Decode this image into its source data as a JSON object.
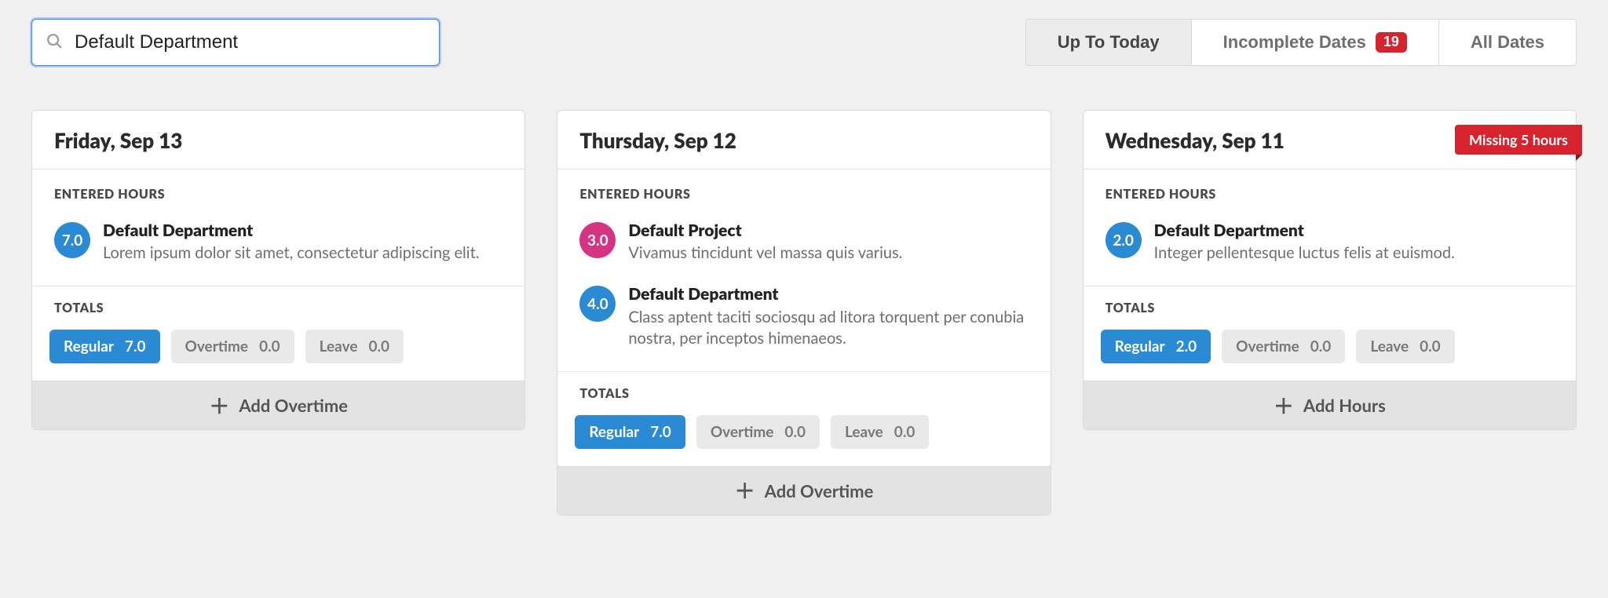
{
  "search": {
    "value": "Default Department"
  },
  "filters": {
    "up_to_today": "Up To Today",
    "incomplete": "Incomplete Dates",
    "incomplete_count": "19",
    "all_dates": "All Dates"
  },
  "labels": {
    "entered_hours": "ENTERED HOURS",
    "totals": "TOTALS",
    "regular": "Regular",
    "overtime": "Overtime",
    "leave": "Leave",
    "add_overtime": "Add Overtime",
    "add_hours": "Add Hours"
  },
  "days": [
    {
      "title": "Friday, Sep 13",
      "ribbon": null,
      "entries": [
        {
          "hours": "7.0",
          "color": "blue",
          "title": "Default Department",
          "desc": "Lorem ipsum dolor sit amet, consectetur adipiscing elit."
        }
      ],
      "totals": {
        "regular": "7.0",
        "overtime": "0.0",
        "leave": "0.0"
      },
      "add_action": "add_overtime"
    },
    {
      "title": "Thursday, Sep 12",
      "ribbon": null,
      "entries": [
        {
          "hours": "3.0",
          "color": "pink",
          "title": "Default Project",
          "desc": "Vivamus tincidunt vel massa quis varius."
        },
        {
          "hours": "4.0",
          "color": "blue",
          "title": "Default Department",
          "desc": "Class aptent taciti sociosqu ad litora torquent per conubia nostra, per inceptos himenaeos."
        }
      ],
      "totals": {
        "regular": "7.0",
        "overtime": "0.0",
        "leave": "0.0"
      },
      "add_action": "add_overtime"
    },
    {
      "title": "Wednesday, Sep 11",
      "ribbon": "Missing 5 hours",
      "entries": [
        {
          "hours": "2.0",
          "color": "blue",
          "title": "Default Department",
          "desc": "Integer pellentesque luctus felis at euismod."
        }
      ],
      "totals": {
        "regular": "2.0",
        "overtime": "0.0",
        "leave": "0.0"
      },
      "add_action": "add_hours"
    }
  ]
}
